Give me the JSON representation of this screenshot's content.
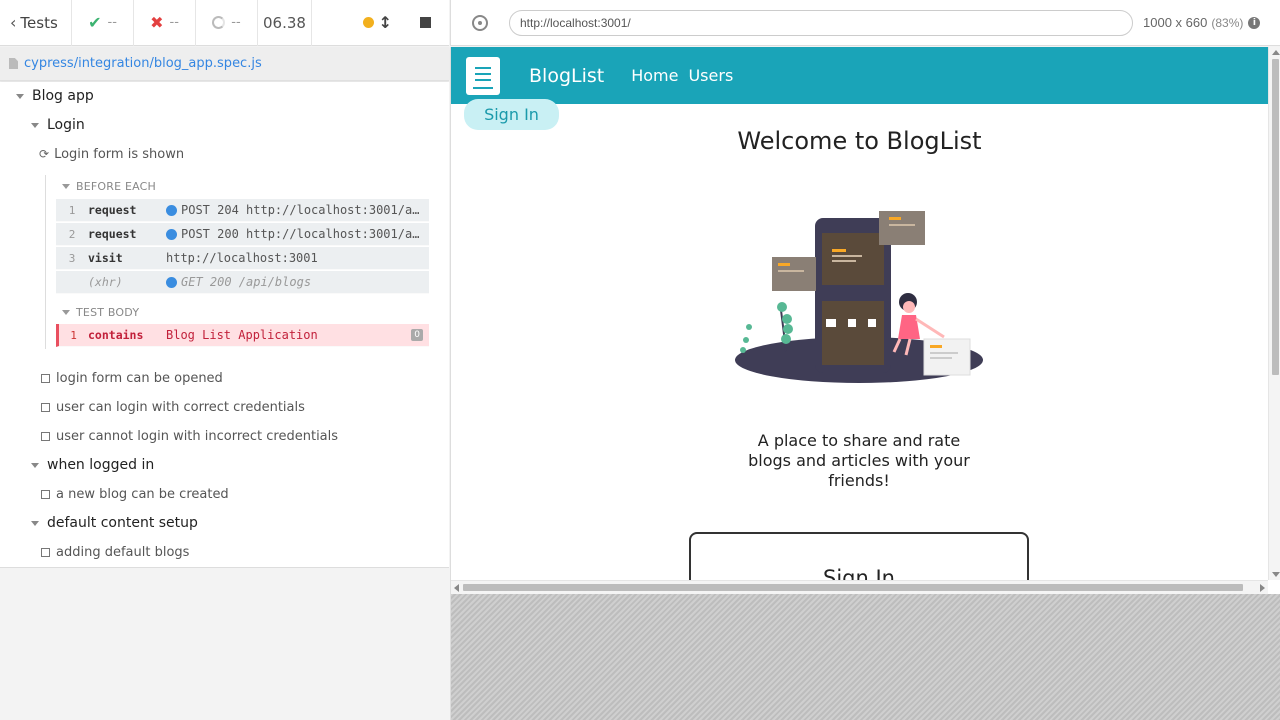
{
  "stats": {
    "tests_label": "Tests",
    "passed": "--",
    "failed": "--",
    "pending": "--",
    "duration": "06.38"
  },
  "spec": {
    "path": "cypress/integration/blog_app.spec.js"
  },
  "runnables": {
    "root_suite": "Blog app",
    "login_suite": "Login",
    "running_test": "Login form is shown",
    "before_each_label": "BEFORE EACH",
    "test_body_label": "TEST BODY",
    "before_each_cmds": [
      {
        "num": "1",
        "name": "request",
        "msg": "POST 204 http://localhost:3001/a…"
      },
      {
        "num": "2",
        "name": "request",
        "msg": "POST 200 http://localhost:3001/a…"
      },
      {
        "num": "3",
        "name": "visit",
        "msg": "http://localhost:3001"
      },
      {
        "num": "",
        "name": "(xhr)",
        "msg": "GET 200 /api/blogs"
      }
    ],
    "test_body_cmds": [
      {
        "num": "1",
        "name": "contains",
        "msg": "Blog List Application",
        "badge": "0"
      }
    ],
    "login_tests": [
      "login form can be opened",
      "user can login with correct credentials",
      "user cannot login with incorrect credentials"
    ],
    "logged_in_suite": "when logged in",
    "logged_in_tests": [
      "a new blog can be created"
    ],
    "default_suite": "default content setup",
    "default_tests": [
      "adding default blogs"
    ]
  },
  "browser": {
    "url": "http://localhost:3001/",
    "viewport": "1000 x 660",
    "zoom": "(83%)",
    "info_icon": "i"
  },
  "app": {
    "brand": "BlogList",
    "nav": [
      "Home",
      "Users"
    ],
    "sign_in_button": "Sign In",
    "welcome": "Welcome to BlogList",
    "tagline": "A place to share and rate blogs and articles with your friends!",
    "sign_in_card_title": "Sign In",
    "colors": {
      "navbar": "#1aa4b8",
      "sign_in_bg": "#c9f0f4"
    }
  }
}
